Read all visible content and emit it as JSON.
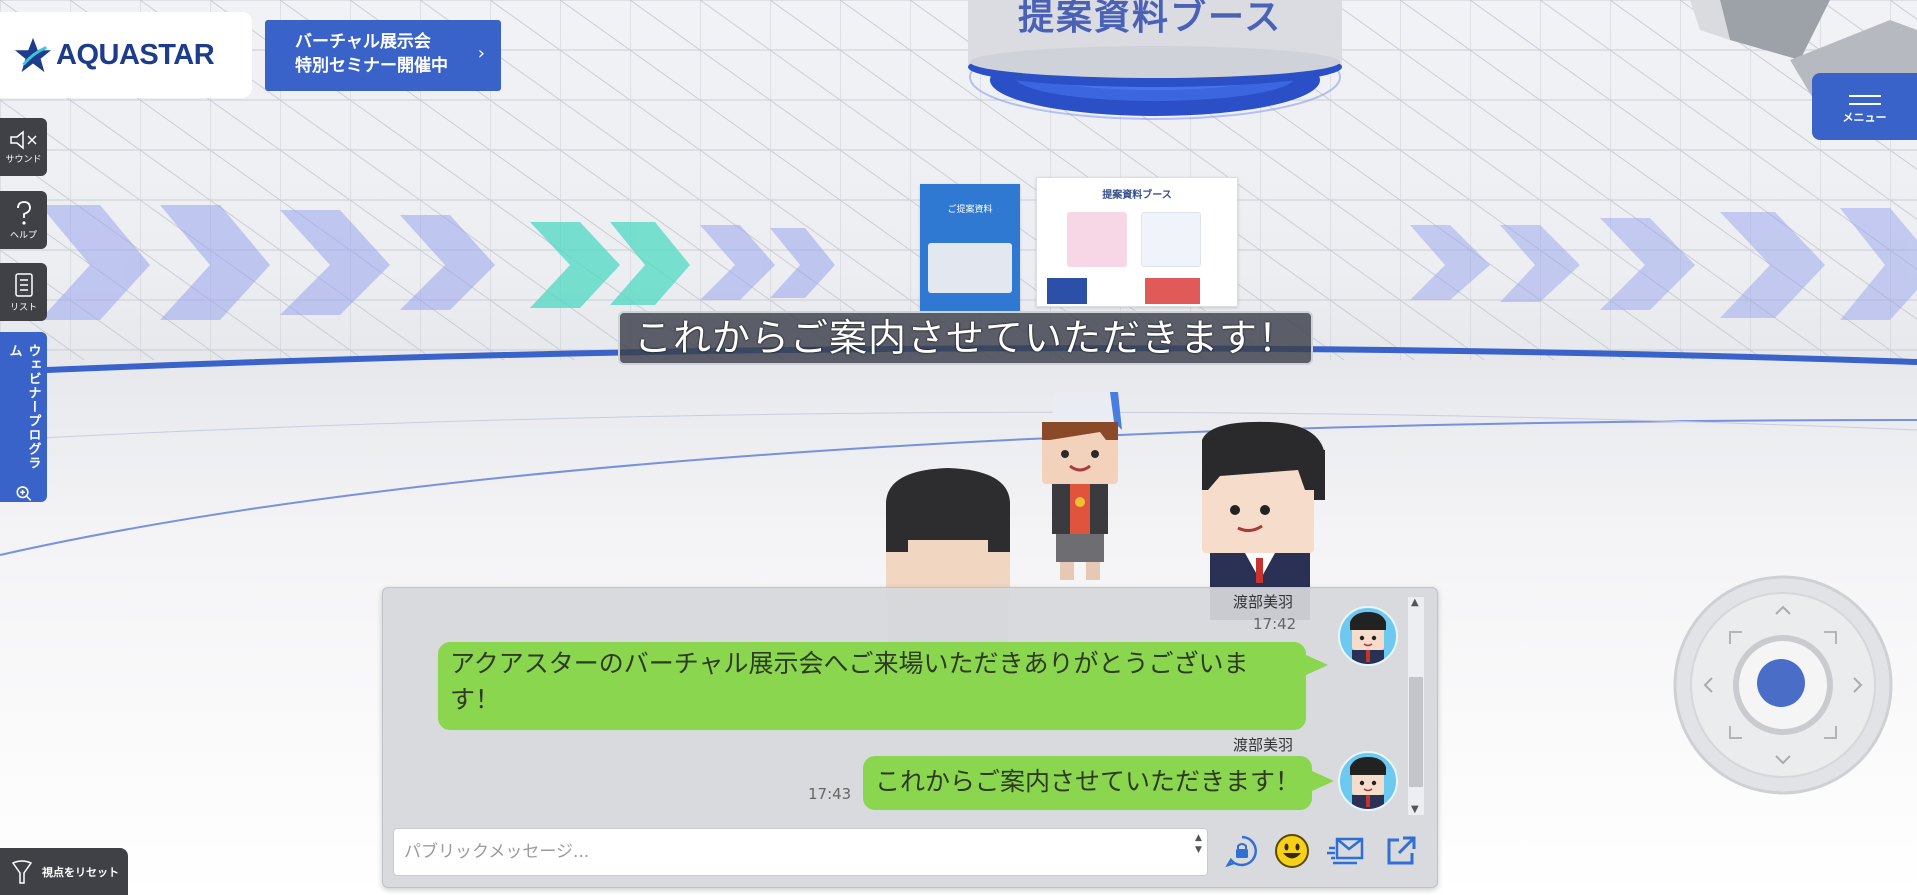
{
  "brand": {
    "logo_text": "AQUASTAR"
  },
  "seminar": {
    "line1": "バーチャル展示会",
    "line2": "特別セミナー開催中",
    "chevron": "›"
  },
  "rail": {
    "sound": "サウンド",
    "help": "ヘルプ",
    "list": "リスト",
    "webinar": "ウェビナープログラム",
    "reset": "視点をリセット"
  },
  "menu": {
    "label": "メニュー"
  },
  "scene": {
    "booth_sign": "提案資料ブース",
    "panel_left_title": "ご提案資料",
    "panel_right_title": "提案資料ブース",
    "caption": "これからご案内させていただきます！"
  },
  "chat": {
    "messages": [
      {
        "name": "渡部美羽",
        "time": "17:42",
        "text_line1": "アクアスターのバーチャル展示会へご来場いただきありがとうございま",
        "text_line2": "す！"
      },
      {
        "name": "渡部美羽",
        "time": "17:43",
        "text": "これからご案内させていただきます！"
      }
    ],
    "input_placeholder": "パブリックメッセージ..."
  },
  "colors": {
    "accent": "#3a63c9",
    "bubble": "#8ad64f",
    "rail": "#3f4147"
  },
  "icons": [
    "star-logo-icon",
    "sound-muted-icon",
    "help-icon",
    "list-icon",
    "zoom-icon",
    "reset-view-icon",
    "menu-icon",
    "private-chat-icon",
    "emoji-icon",
    "mail-icon",
    "external-link-icon"
  ]
}
